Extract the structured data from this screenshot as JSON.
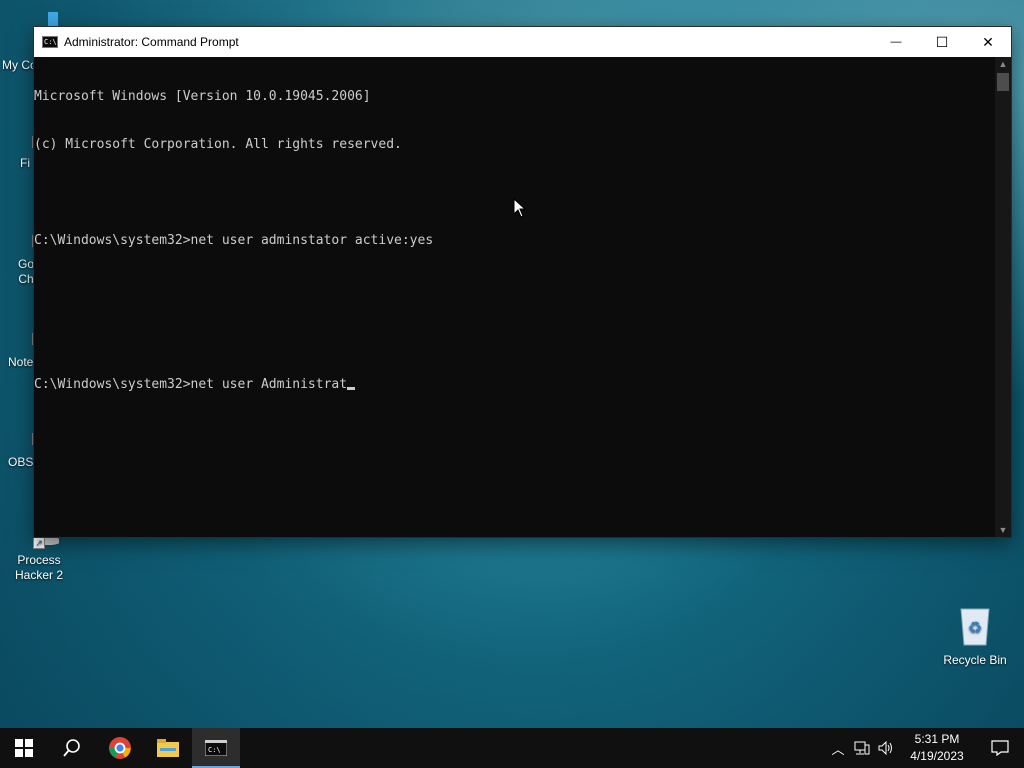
{
  "desktop": {
    "icons": [
      {
        "label": "My Co"
      },
      {
        "label": "Fi"
      },
      {
        "label": "Go\nCh"
      },
      {
        "label": "Note"
      },
      {
        "label": "OBS"
      },
      {
        "label": "Process\nHacker 2"
      },
      {
        "label": "Recycle Bin"
      }
    ]
  },
  "window": {
    "title": "Administrator: Command Prompt",
    "controls": {
      "minimize": "—",
      "maximize": "☐",
      "close": "✕"
    }
  },
  "console": {
    "lines": [
      "Microsoft Windows [Version 10.0.19045.2006]",
      "(c) Microsoft Corporation. All rights reserved.",
      "",
      "C:\\Windows\\system32>net user adminstator active:yes",
      "",
      "",
      "C:\\Windows\\system32>net user Administrat"
    ]
  },
  "taskbar": {
    "clock_time": "5:31 PM",
    "clock_date": "4/19/2023"
  }
}
